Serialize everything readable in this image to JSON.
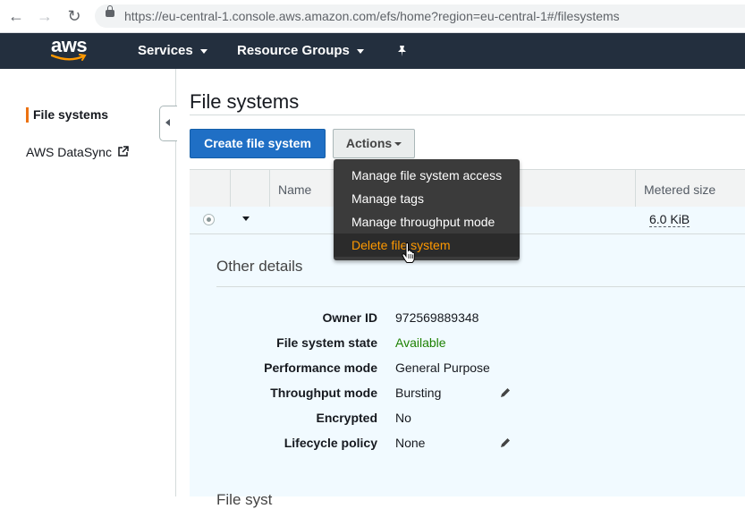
{
  "browser": {
    "url": "https://eu-central-1.console.aws.amazon.com/efs/home?region=eu-central-1#/filesystems",
    "back_icon": "←",
    "forward_icon": "→",
    "reload_icon": "↻"
  },
  "topnav": {
    "logo": "aws",
    "services": "Services",
    "resource_groups": "Resource Groups",
    "pin_icon": "📌"
  },
  "sidebar": {
    "items": [
      {
        "label": "File systems",
        "active": true
      },
      {
        "label": "AWS DataSync",
        "external": true
      }
    ]
  },
  "main": {
    "title": "File systems",
    "create_button": "Create file system",
    "actions_button": "Actions",
    "table": {
      "columns": [
        "",
        "",
        "Name",
        "Metered size"
      ],
      "rows": [
        {
          "selected": true,
          "name": "",
          "metered_size": "6.0 KiB"
        }
      ]
    },
    "details": {
      "title": "Other details",
      "fields": [
        {
          "label": "Owner ID",
          "value": "972569889348"
        },
        {
          "label": "File system state",
          "value": "Available"
        },
        {
          "label": "Performance mode",
          "value": "General Purpose"
        },
        {
          "label": "Throughput mode",
          "value": "Bursting"
        },
        {
          "label": "Encrypted",
          "value": "No"
        },
        {
          "label": "Lifecycle policy",
          "value": "None"
        }
      ],
      "next_section_title": "File syst"
    }
  },
  "actions_menu": {
    "items": [
      "Manage file system access",
      "Manage tags",
      "Manage throughput mode",
      "Delete file system"
    ],
    "highlighted_index": 3
  },
  "colors": {
    "aws_nav": "#232f3e",
    "primary_button": "#1f6fc5",
    "available_green": "#1d8102",
    "menu_highlight_text": "#ff9900",
    "sidebar_accent": "#ec7211"
  }
}
